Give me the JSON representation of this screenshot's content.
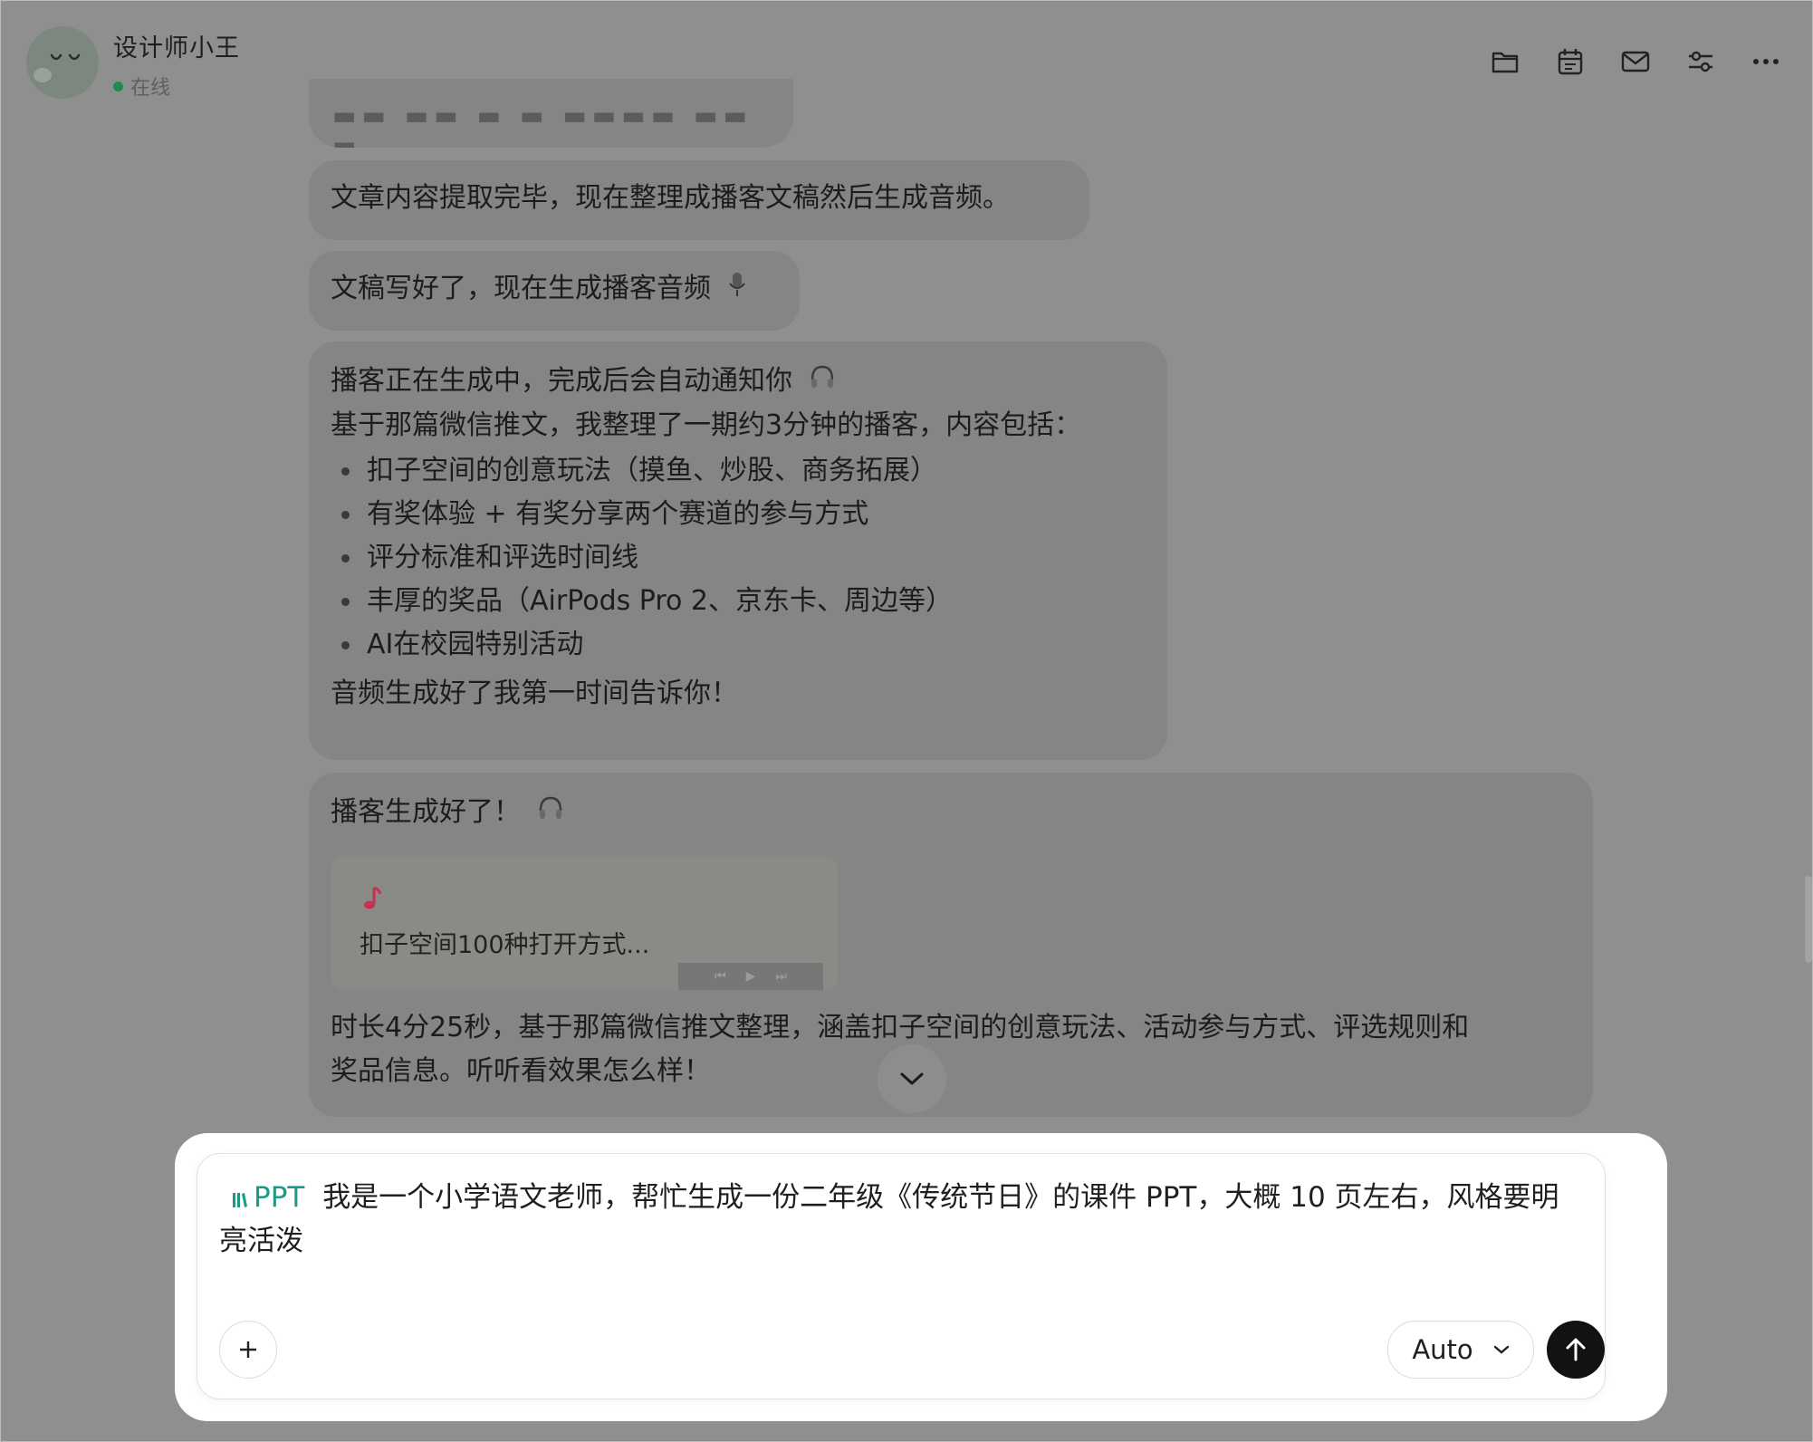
{
  "header": {
    "title": "设计师小王",
    "status": "在线",
    "icons": [
      "folder-icon",
      "calendar-icon",
      "mail-icon",
      "settings-icon",
      "more-icon"
    ]
  },
  "messages": {
    "m1": "文章内容提取完毕，现在整理成播客文稿然后生成音频。",
    "m2": "文稿写好了，现在生成播客音频",
    "m3": {
      "line1": "播客正在生成中，完成后会自动通知你",
      "line2": "基于那篇微信推文，我整理了一期约3分钟的播客，内容包括：",
      "bullets": [
        "扣子空间的创意玩法（摸鱼、炒股、商务拓展）",
        "有奖体验 + 有奖分享两个赛道的参与方式",
        "评分标准和评选时间线",
        "丰厚的奖品（AirPods Pro 2、京东卡、周边等）",
        "AI在校园特别活动"
      ],
      "line3": "音频生成好了我第一时间告诉你！"
    },
    "m4": {
      "line1": "播客生成好了！",
      "audio_title": "扣子空间100种打开方式...",
      "desc1": "时长4分25秒，基于那篇微信推文整理，涵盖扣子空间的创意玩法、活动参与方式、评选规则和",
      "desc2": "奖品信息。听听看效果怎么样！"
    }
  },
  "composer": {
    "tag": "PPT",
    "text": "我是一个小学语文老师，帮忙生成一份二年级《传统节日》的课件 PPT，大概 10 页左右，风格要明亮活泼",
    "model": "Auto"
  },
  "colors": {
    "accent": "#1b9a8a",
    "online": "#1f8a53",
    "overlay": "#8f8f8f",
    "send": "#121212"
  }
}
